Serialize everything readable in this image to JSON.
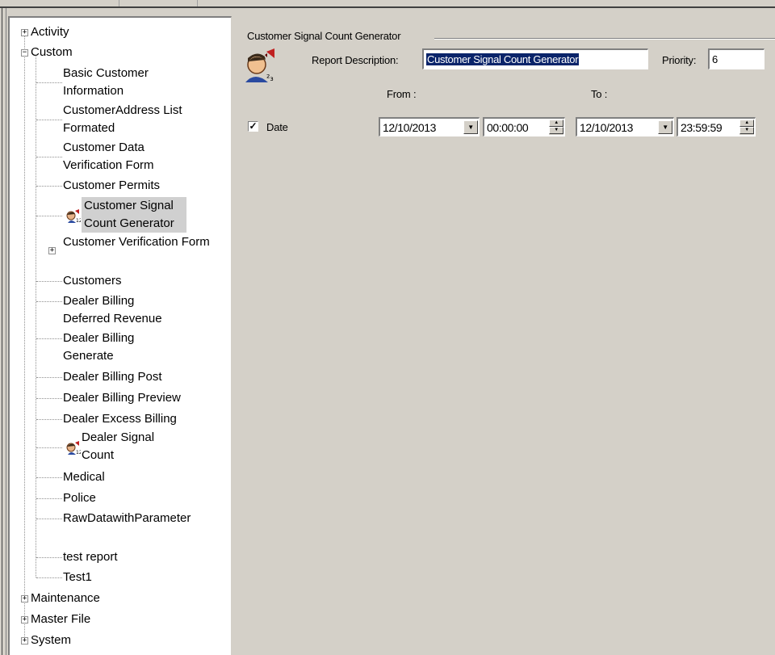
{
  "tree": {
    "items": [
      {
        "label": "Activity"
      },
      {
        "label": "Custom"
      },
      {
        "label": "Basic Customer Information"
      },
      {
        "label": "CustomerAddress List Formated"
      },
      {
        "label": "Customer Data Verification Form"
      },
      {
        "label": "Customer Permits"
      },
      {
        "label": "Customer Signal Count Generator"
      },
      {
        "label": "Customer Verification Form"
      },
      {
        "label": "Customers"
      },
      {
        "label": "Dealer Billing Deferred Revenue"
      },
      {
        "label": "Dealer Billing Generate"
      },
      {
        "label": "Dealer Billing Post"
      },
      {
        "label": "Dealer Billing Preview"
      },
      {
        "label": "Dealer Excess Billing"
      },
      {
        "label": "Dealer Signal Count"
      },
      {
        "label": "Medical"
      },
      {
        "label": "Police"
      },
      {
        "label": "RawDatawithParameter"
      },
      {
        "label": "test report"
      },
      {
        "label": "Test1"
      },
      {
        "label": "Maintenance"
      },
      {
        "label": "Master File"
      },
      {
        "label": "System"
      }
    ],
    "expander_plus": "+",
    "expander_minus": "−"
  },
  "form": {
    "group_title": "Customer Signal Count Generator",
    "report_description_label": "Report Description:",
    "report_description_value": "Customer Signal Count Generator",
    "priority_label": "Priority:",
    "priority_value": "6",
    "from_label": "From :",
    "to_label": "To :",
    "date_label": "Date",
    "date_checked": true,
    "check_mark": "✓",
    "from_date": "12/10/2013",
    "from_time": "00:00:00",
    "to_date": "12/10/2013",
    "to_time": "23:59:59",
    "dropdown_glyph": "▼",
    "spin_up": "▲",
    "spin_down": "▼"
  },
  "colors": {
    "selection_highlight": "#0a246a",
    "tree_selected_bg": "#d0d0d0",
    "dialog_bg": "#d4d0c8"
  }
}
